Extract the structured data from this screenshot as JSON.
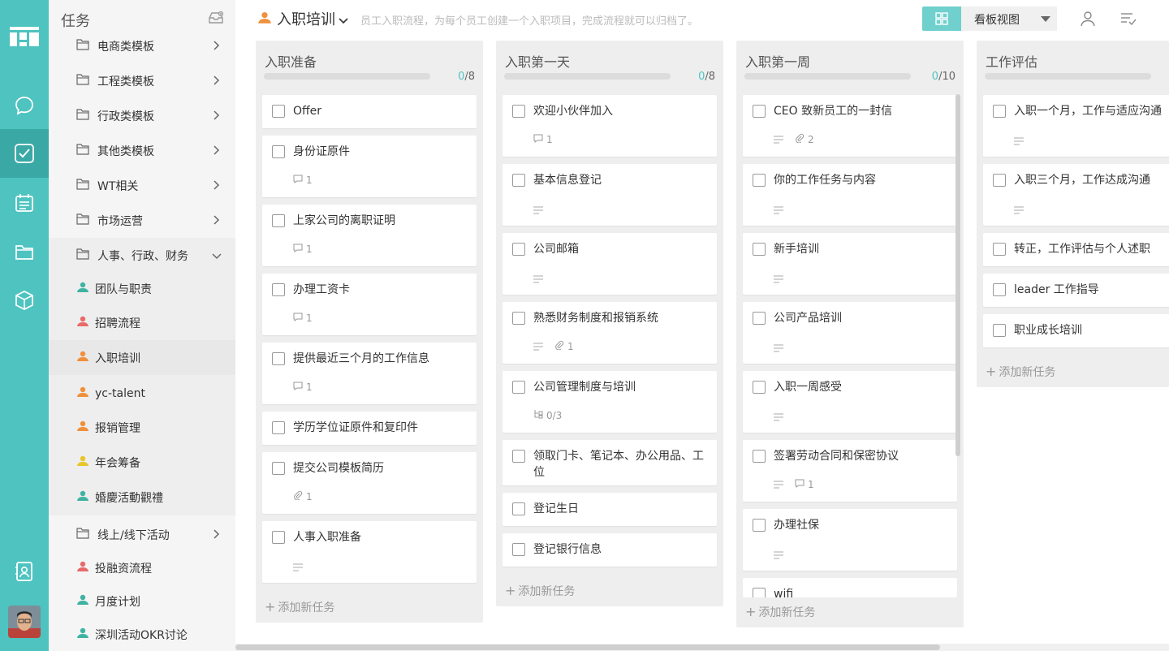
{
  "sidebar": {
    "title": "任务",
    "folders_top": [
      {
        "label": "电商类模板"
      },
      {
        "label": "工程类模板"
      },
      {
        "label": "行政类模板"
      },
      {
        "label": "其他类模板"
      },
      {
        "label": "WT相关"
      },
      {
        "label": "市场运营"
      },
      {
        "label": "人事、行政、财务"
      }
    ],
    "projects": [
      {
        "label": "团队与职责",
        "color": "#3fb3a2"
      },
      {
        "label": "招聘流程",
        "color": "#e86a6a"
      },
      {
        "label": "入职培训",
        "color": "#f0903c"
      },
      {
        "label": "yc-talent",
        "color": "#f0903c"
      },
      {
        "label": "报销管理",
        "color": "#f0903c"
      },
      {
        "label": "年会筹备",
        "color": "#e8c62a"
      },
      {
        "label": "婚慶活動觀禮",
        "color": "#3fb3a2"
      }
    ],
    "folders_bottom": [
      {
        "label": "线上/线下活动"
      }
    ],
    "projects_bottom": [
      {
        "label": "投融资流程",
        "color": "#e86a6a"
      },
      {
        "label": "月度计划",
        "color": "#3fb3a2"
      },
      {
        "label": "深圳活动OKR讨论",
        "color": "#3fb3a2"
      }
    ]
  },
  "header": {
    "title": "入职培训",
    "description": "员工入职流程，为每个员工创建一个入职项目，完成流程就可以归档了。",
    "view_label": "看板视图"
  },
  "columns": [
    {
      "title": "入职准备",
      "done": "0",
      "total": "/8",
      "add_label": "添加新任务",
      "cards": [
        {
          "text": "Offer"
        },
        {
          "text": "身份证原件",
          "comments": "1"
        },
        {
          "text": "上家公司的离职证明",
          "comments": "1"
        },
        {
          "text": "办理工资卡",
          "comments": "1"
        },
        {
          "text": "提供最近三个月的工作信息",
          "comments": "1"
        },
        {
          "text": "学历学位证原件和复印件"
        },
        {
          "text": "提交公司模板简历",
          "attachments": "1"
        },
        {
          "text": "人事入职准备",
          "desc": true
        }
      ]
    },
    {
      "title": "入职第一天",
      "done": "0",
      "total": "/8",
      "add_label": "添加新任务",
      "cards": [
        {
          "text": "欢迎小伙伴加入",
          "comments": "1"
        },
        {
          "text": "基本信息登记",
          "desc": true
        },
        {
          "text": "公司邮箱",
          "desc": true
        },
        {
          "text": "熟悉财务制度和报销系统",
          "desc": true,
          "attachments": "1"
        },
        {
          "text": "公司管理制度与培训",
          "subtasks": "0/3"
        },
        {
          "text": "领取门卡、笔记本、办公用品、工位"
        },
        {
          "text": "登记生日"
        },
        {
          "text": "登记银行信息"
        }
      ]
    },
    {
      "title": "入职第一周",
      "done": "0",
      "total": "/10",
      "add_label": "添加新任务",
      "cards": [
        {
          "text": "CEO 致新员工的一封信",
          "desc": true,
          "attachments": "2"
        },
        {
          "text": "你的工作任务与内容",
          "desc": true
        },
        {
          "text": "新手培训",
          "desc": true
        },
        {
          "text": "公司产品培训",
          "desc": true
        },
        {
          "text": "入职一周感受",
          "desc": true
        },
        {
          "text": "签署劳动合同和保密协议",
          "desc": true,
          "comments": "1"
        },
        {
          "text": "办理社保",
          "desc": true
        },
        {
          "text": "wifi"
        }
      ]
    },
    {
      "title": "工作评估",
      "add_label": "添加新任务",
      "cards": [
        {
          "text": "入职一个月，工作与适应沟通",
          "desc": true
        },
        {
          "text": "入职三个月，工作达成沟通",
          "desc": true
        },
        {
          "text": "转正，工作评估与个人述职"
        },
        {
          "text": "leader 工作指导"
        },
        {
          "text": "职业成长培训"
        }
      ]
    }
  ],
  "colors": {
    "accent": "#4ec3c0",
    "rail": "#4ec3c0"
  }
}
